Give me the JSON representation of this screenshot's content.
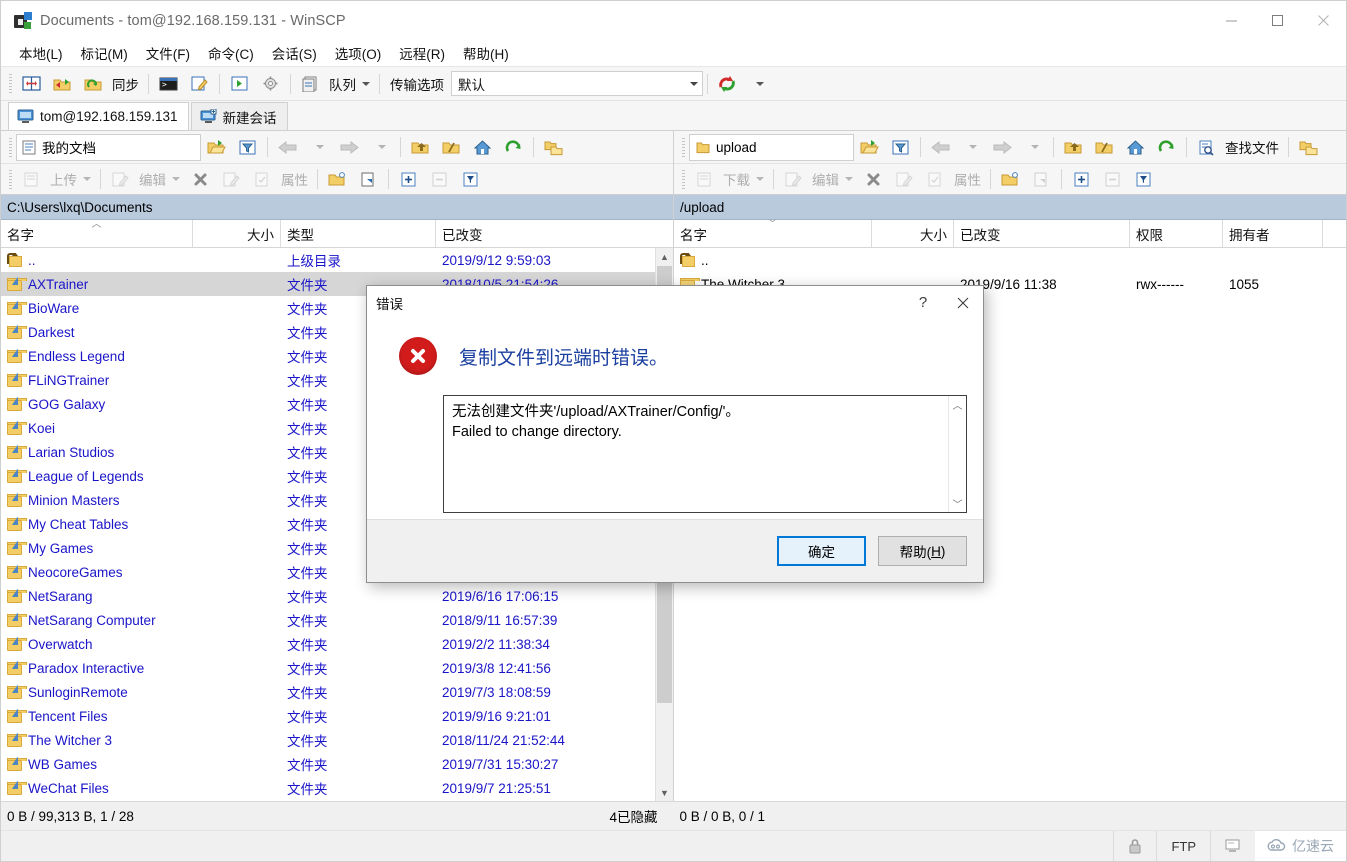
{
  "window": {
    "title": "Documents - tom@192.168.159.131 - WinSCP",
    "minimize": "minimize-icon",
    "maximize": "maximize-icon",
    "close": "close-icon"
  },
  "menu": {
    "items": [
      {
        "label": "本地(L)"
      },
      {
        "label": "标记(M)"
      },
      {
        "label": "文件(F)"
      },
      {
        "label": "命令(C)"
      },
      {
        "label": "会话(S)"
      },
      {
        "label": "选项(O)"
      },
      {
        "label": "远程(R)"
      },
      {
        "label": "帮助(H)"
      }
    ]
  },
  "toolbar": {
    "sync_label": "同步",
    "queue_label": "队列",
    "transfer_options_label": "传输选项",
    "transfer_options_value": "默认"
  },
  "tabs": [
    {
      "label": "tom@192.168.159.131",
      "active": true
    },
    {
      "label": "新建会话",
      "active": false
    }
  ],
  "left_pane": {
    "drive_label": "我的文档",
    "path": "C:\\Users\\lxq\\Documents",
    "actions": {
      "upload": "上传",
      "edit": "编辑",
      "properties": "属性"
    },
    "columns": [
      {
        "label": "名字",
        "align": "left",
        "sorted": "asc"
      },
      {
        "label": "大小",
        "align": "right"
      },
      {
        "label": "类型",
        "align": "left"
      },
      {
        "label": "已改变",
        "align": "left"
      }
    ],
    "rows": [
      {
        "name": "..",
        "icon": "parent-folder-icon",
        "size": "",
        "type": "上级目录",
        "changed": "2019/9/12  9:59:03",
        "selected": false
      },
      {
        "name": "AXTrainer",
        "icon": "folder-shortcut-icon",
        "size": "",
        "type": "文件夹",
        "changed": "2018/10/5  21:54:26",
        "selected": true
      },
      {
        "name": "BioWare",
        "icon": "folder-shortcut-icon",
        "size": "",
        "type": "文件夹",
        "changed": "",
        "selected": false
      },
      {
        "name": "Darkest",
        "icon": "folder-shortcut-icon",
        "size": "",
        "type": "文件夹",
        "changed": "",
        "selected": false
      },
      {
        "name": "Endless Legend",
        "icon": "folder-shortcut-icon",
        "size": "",
        "type": "文件夹",
        "changed": "",
        "selected": false
      },
      {
        "name": "FLiNGTrainer",
        "icon": "folder-shortcut-icon",
        "size": "",
        "type": "文件夹",
        "changed": "",
        "selected": false
      },
      {
        "name": "GOG Galaxy",
        "icon": "folder-shortcut-icon",
        "size": "",
        "type": "文件夹",
        "changed": "",
        "selected": false
      },
      {
        "name": "Koei",
        "icon": "folder-shortcut-icon",
        "size": "",
        "type": "文件夹",
        "changed": "",
        "selected": false
      },
      {
        "name": "Larian Studios",
        "icon": "folder-shortcut-icon",
        "size": "",
        "type": "文件夹",
        "changed": "",
        "selected": false
      },
      {
        "name": "League of Legends",
        "icon": "folder-shortcut-icon",
        "size": "",
        "type": "文件夹",
        "changed": "",
        "selected": false
      },
      {
        "name": "Minion Masters",
        "icon": "folder-shortcut-icon",
        "size": "",
        "type": "文件夹",
        "changed": "",
        "selected": false
      },
      {
        "name": "My Cheat Tables",
        "icon": "folder-shortcut-icon",
        "size": "",
        "type": "文件夹",
        "changed": "",
        "selected": false
      },
      {
        "name": "My Games",
        "icon": "folder-shortcut-icon",
        "size": "",
        "type": "文件夹",
        "changed": "",
        "selected": false
      },
      {
        "name": "NeocoreGames",
        "icon": "folder-shortcut-icon",
        "size": "",
        "type": "文件夹",
        "changed": "",
        "selected": false
      },
      {
        "name": "NetSarang",
        "icon": "folder-shortcut-icon",
        "size": "",
        "type": "文件夹",
        "changed": "2019/6/16  17:06:15",
        "selected": false
      },
      {
        "name": "NetSarang Computer",
        "icon": "folder-shortcut-icon",
        "size": "",
        "type": "文件夹",
        "changed": "2018/9/11  16:57:39",
        "selected": false
      },
      {
        "name": "Overwatch",
        "icon": "folder-shortcut-icon",
        "size": "",
        "type": "文件夹",
        "changed": "2019/2/2  11:38:34",
        "selected": false
      },
      {
        "name": "Paradox Interactive",
        "icon": "folder-shortcut-icon",
        "size": "",
        "type": "文件夹",
        "changed": "2019/3/8  12:41:56",
        "selected": false
      },
      {
        "name": "SunloginRemote",
        "icon": "folder-shortcut-icon",
        "size": "",
        "type": "文件夹",
        "changed": "2019/7/3  18:08:59",
        "selected": false
      },
      {
        "name": "Tencent Files",
        "icon": "folder-shortcut-icon",
        "size": "",
        "type": "文件夹",
        "changed": "2019/9/16  9:21:01",
        "selected": false
      },
      {
        "name": "The Witcher 3",
        "icon": "folder-shortcut-icon",
        "size": "",
        "type": "文件夹",
        "changed": "2018/11/24  21:52:44",
        "selected": false
      },
      {
        "name": "WB Games",
        "icon": "folder-shortcut-icon",
        "size": "",
        "type": "文件夹",
        "changed": "2019/7/31  15:30:27",
        "selected": false
      },
      {
        "name": "WeChat Files",
        "icon": "folder-shortcut-icon",
        "size": "",
        "type": "文件夹",
        "changed": "2019/9/7  21:25:51",
        "selected": false
      }
    ]
  },
  "right_pane": {
    "drive_label": "upload",
    "path": "/upload",
    "find_files_label": "查找文件",
    "actions": {
      "download": "下载",
      "edit": "编辑",
      "properties": "属性"
    },
    "columns": [
      {
        "label": "名字",
        "align": "left",
        "sorted": "desc"
      },
      {
        "label": "大小",
        "align": "right"
      },
      {
        "label": "已改变",
        "align": "left"
      },
      {
        "label": "权限",
        "align": "left"
      },
      {
        "label": "拥有者",
        "align": "left"
      }
    ],
    "rows": [
      {
        "name": "..",
        "icon": "parent-folder-icon",
        "size": "",
        "changed": "",
        "rights": "",
        "owner": ""
      },
      {
        "name": "The Witcher 3",
        "icon": "folder-icon",
        "size": "",
        "changed": "2019/9/16 11:38",
        "rights": "rwx------",
        "owner": "1055"
      }
    ]
  },
  "status": {
    "left_text": "0 B / 99,313 B,   1 / 28",
    "hidden_text": "4已隐藏",
    "right_text": "0 B / 0 B,  0 / 1",
    "lock_icon": "lock-icon",
    "protocol": "FTP",
    "terminal_icon": "terminal-icon",
    "watermark": "亿速云"
  },
  "dialog": {
    "title": "错误",
    "help_btn": "?",
    "close_btn": "✕",
    "icon": "error-icon",
    "heading": "复制文件到远端时错误。",
    "details_line1": "无法创建文件夹'/upload/AXTrainer/Config/'。",
    "details_line2": "Failed to change directory.",
    "ok_label": "确定",
    "help_label": "帮助(H)",
    "help_label_pre": "帮助(",
    "help_label_key": "H",
    "help_label_post": ")"
  },
  "colors": {
    "accent": "#0078d7",
    "error_red": "#d21c1c",
    "folder_text": "#1a14c8",
    "heading_blue": "#1a3fa0",
    "addrbar": "#b9cadd"
  }
}
